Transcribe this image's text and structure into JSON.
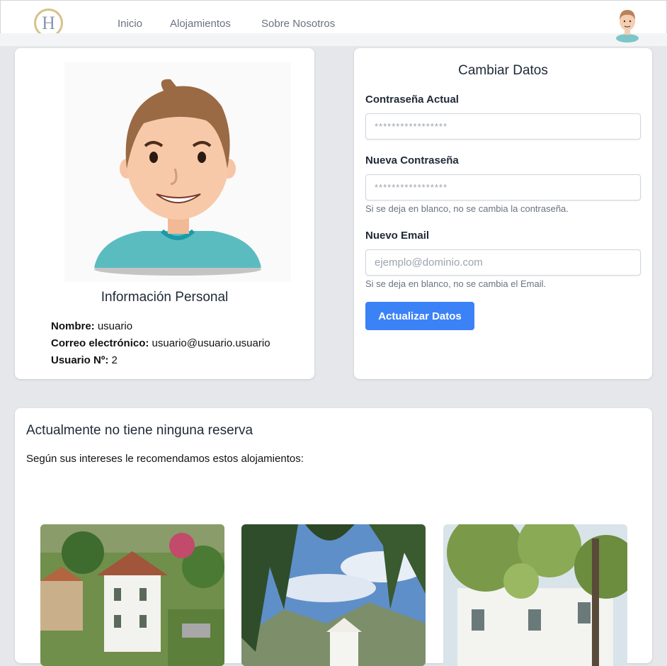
{
  "nav": {
    "logo_letter": "H",
    "links": [
      "Inicio",
      "Alojamientos",
      "Sobre Nosotros"
    ]
  },
  "profile": {
    "title": "Información Personal",
    "name_label": "Nombre:",
    "name_value": "usuario",
    "email_label": "Correo electrónico:",
    "email_value": "usuario@usuario.usuario",
    "user_num_label": "Usuario Nº:",
    "user_num_value": "2"
  },
  "form": {
    "title": "Cambiar Datos",
    "current_password_label": "Contraseña Actual",
    "current_password_placeholder": "*****************",
    "new_password_label": "Nueva Contraseña",
    "new_password_placeholder": "*****************",
    "new_password_help": "Si se deja en blanco, no se cambia la contraseña.",
    "new_email_label": "Nuevo Email",
    "new_email_placeholder": "ejemplo@dominio.com",
    "new_email_help": "Si se deja en blanco, no se cambia el Email.",
    "submit_label": "Actualizar Datos"
  },
  "reservations": {
    "title": "Actualmente no tiene ninguna reserva",
    "subtitle": "Según sus intereses le recomendamos estos alojamientos:"
  },
  "colors": {
    "accent": "#3b82f6",
    "logo_ring": "#d9c08a",
    "shirt": "#5bbcc0"
  }
}
